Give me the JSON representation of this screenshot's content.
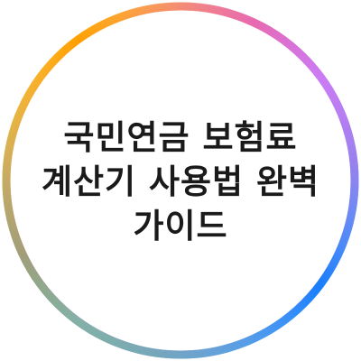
{
  "title": {
    "lines": [
      "국민연금 보험료",
      "계산기 사용법 완벽",
      "가이드"
    ]
  },
  "colors": {
    "background": "#ffffff",
    "text": "#1a1a1a",
    "ring_gradient": [
      "#ff3b30",
      "#ff9500",
      "#ffd60a",
      "#34c759",
      "#00c7be",
      "#0a84ff",
      "#5e5ce6",
      "#bf5af2",
      "#ff2d55"
    ]
  }
}
